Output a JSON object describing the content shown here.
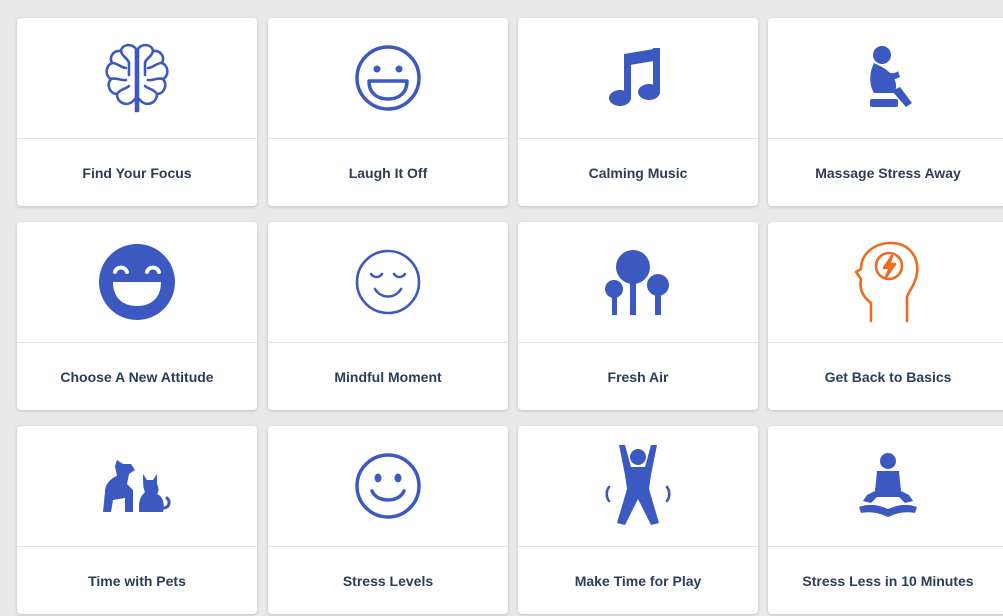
{
  "colors": {
    "primary": "#3c59c2",
    "accent": "#ee6a1e",
    "text": "#2c3e57"
  },
  "cards": [
    {
      "label": "Find Your Focus",
      "icon": "brain-icon"
    },
    {
      "label": "Laugh It Off",
      "icon": "laughing-face-icon"
    },
    {
      "label": "Calming Music",
      "icon": "music-note-icon"
    },
    {
      "label": "Massage Stress Away",
      "icon": "massage-person-icon"
    },
    {
      "label": "Choose A New Attitude",
      "icon": "big-smile-face-icon"
    },
    {
      "label": "Mindful Moment",
      "icon": "calm-face-icon"
    },
    {
      "label": "Fresh Air",
      "icon": "trees-icon"
    },
    {
      "label": "Get Back to Basics",
      "icon": "head-lightning-icon"
    },
    {
      "label": "Time with Pets",
      "icon": "pets-icon"
    },
    {
      "label": "Stress Levels",
      "icon": "smiley-face-icon"
    },
    {
      "label": "Make Time for Play",
      "icon": "jumping-person-icon"
    },
    {
      "label": "Stress Less in 10 Minutes",
      "icon": "meditation-icon"
    }
  ]
}
